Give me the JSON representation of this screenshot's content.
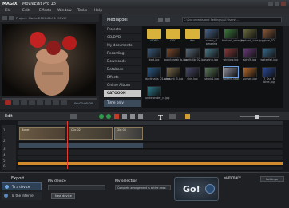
{
  "app": {
    "logo": "MAGIX",
    "title": "MovieEdit Pro 15",
    "menu": [
      "File",
      "Edit",
      "Effects",
      "Window",
      "Tasks",
      "Help"
    ]
  },
  "preview": {
    "project_label": "Project: Movie 2009-04-21 MOVIE",
    "timecode": "00:00:00:00"
  },
  "media_pool": {
    "header": "Mediapool",
    "path": "C:\\Documents and Settings\\All Users\\...",
    "nav": [
      "Projects",
      "CD/DVD",
      "My documents",
      "Recording",
      "Downloads",
      "Database",
      "Effects",
      "Online Album",
      "CATOOOH"
    ],
    "time_btn": "Time only",
    "items": [
      {
        "label": "VIDEO",
        "color": "#d8b23a"
      },
      {
        "label": "DSC",
        "color": "#d8b23a"
      },
      {
        "label": "doc",
        "color": "#d8b23a"
      },
      {
        "label": "comic_xl amazing",
        "color": "#46628a"
      },
      {
        "label": "football_wow.jpg",
        "color": "#3c7a3c"
      },
      {
        "label": "football_nice.jpg",
        "color": "#6a6a3c"
      },
      {
        "label": "glow_02",
        "color": "#8a5a3a"
      },
      {
        "label": "bad.jpg",
        "color": "#3a5a7a"
      },
      {
        "label": "pointbreak_b.jpg",
        "color": "#7a4a2a"
      },
      {
        "label": "fcaefp4b_02.jpg",
        "color": "#5a6a7a"
      },
      {
        "label": "swing.jpg",
        "color": "#4a7a8a"
      },
      {
        "label": "window.jpg",
        "color": "#8a3a3a"
      },
      {
        "label": "skinflt.jpg",
        "color": "#6a3a7a"
      },
      {
        "label": "waterfall.jpg",
        "color": "#3a6a8a"
      },
      {
        "label": "doctinatis_01a.jpg",
        "color": "#2a5a8a"
      },
      {
        "label": "gruscht_3.jpg",
        "color": "#7a6a4a"
      },
      {
        "label": "skin.jpg",
        "color": "#4a4a6a"
      },
      {
        "label": "stuck1.jpg",
        "color": "#5a7a5a"
      },
      {
        "label": "speech.png",
        "color": "#8a8a9a"
      },
      {
        "label": "sunset.jpg",
        "color": "#b86a2a"
      },
      {
        "label": "T_Dut_6 blue.jpg",
        "color": "#2a4a9a"
      },
      {
        "label": "underwater_cl.jpg",
        "color": "#2a7a8a"
      }
    ]
  },
  "edit": {
    "label": "Edit"
  },
  "timeline": {
    "tracks": [
      "1",
      "2",
      "3",
      "4",
      "5",
      "6"
    ],
    "clips": [
      {
        "label": "Boxer"
      },
      {
        "label": "Clip 02"
      },
      {
        "label": "Clip 03"
      }
    ]
  },
  "export": {
    "section_label": "Export",
    "to_device": "To a device",
    "to_internet": "To the Internet",
    "my_device_label": "My device",
    "device_value": "",
    "new_device": "New device",
    "my_selection_label": "My selection",
    "selection_value": "Complete arrangement is active (max 3)",
    "go": "Go!",
    "summary": "Summary",
    "settings": "Settings"
  },
  "colors": {
    "accent": "#e23b2f",
    "orange_track": "#d28a2e",
    "bg": "#1b1d20"
  }
}
